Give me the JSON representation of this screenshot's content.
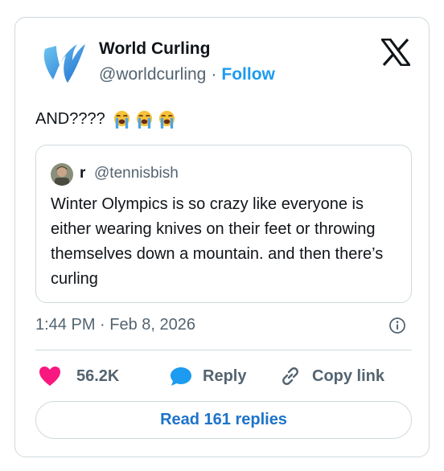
{
  "author": {
    "name": "World Curling",
    "handle": "@worldcurling",
    "separator": "·",
    "follow_label": "Follow"
  },
  "tweet": {
    "text": "AND????",
    "emojis": [
      "loudly-crying-face",
      "loudly-crying-face",
      "loudly-crying-face"
    ]
  },
  "quote": {
    "name": "r",
    "handle": "@tennisbish",
    "text": "Winter Olympics is so crazy like everyone is either wearing knives on their feet or throwing themselves down a mountain. and then there’s curling"
  },
  "meta": {
    "timestamp": "1:44 PM · Feb 8, 2026"
  },
  "actions": {
    "likes": "56.2K",
    "reply_label": "Reply",
    "copy_label": "Copy link"
  },
  "replies_button": {
    "label": "Read 161 replies"
  },
  "colors": {
    "accent": "#1d9bf0",
    "like": "#f91880",
    "border": "#cfd9de",
    "muted": "#536471"
  },
  "icons": {
    "brand": "x-logo-icon",
    "info": "info-icon",
    "like": "heart-icon",
    "reply": "reply-bubble-icon",
    "copy": "link-icon"
  }
}
